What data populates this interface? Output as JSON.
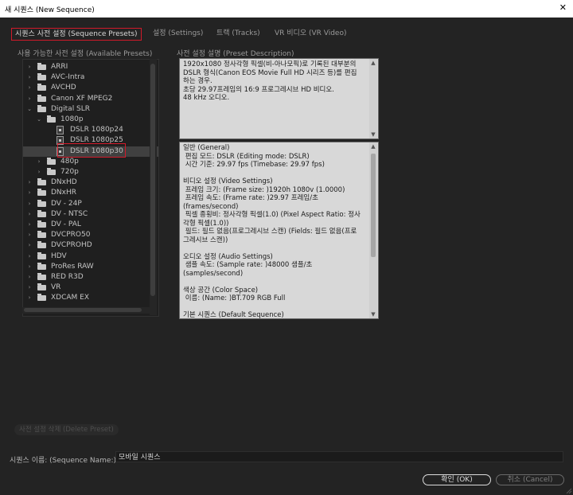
{
  "window": {
    "title": "새 시퀀스 (New Sequence)",
    "close": "✕"
  },
  "tabs": [
    {
      "label": "시퀀스 사전 설정 (Sequence Presets)"
    },
    {
      "label": "설정 (Settings)"
    },
    {
      "label": "트랙 (Tracks)"
    },
    {
      "label": "VR 비디오 (VR Video)"
    }
  ],
  "available_presets": {
    "label": "사용 가능한 사전 설정 (Available Presets)",
    "items": [
      {
        "label": "ARRI",
        "type": "folder",
        "depth": 0,
        "expanded": false
      },
      {
        "label": "AVC-Intra",
        "type": "folder",
        "depth": 0,
        "expanded": false
      },
      {
        "label": "AVCHD",
        "type": "folder",
        "depth": 0,
        "expanded": false
      },
      {
        "label": "Canon XF MPEG2",
        "type": "folder",
        "depth": 0,
        "expanded": false
      },
      {
        "label": "Digital SLR",
        "type": "folder",
        "depth": 0,
        "expanded": true
      },
      {
        "label": "1080p",
        "type": "folder",
        "depth": 1,
        "expanded": true
      },
      {
        "label": "DSLR 1080p24",
        "type": "preset",
        "depth": 2
      },
      {
        "label": "DSLR 1080p25",
        "type": "preset",
        "depth": 2
      },
      {
        "label": "DSLR 1080p30",
        "type": "preset",
        "depth": 2,
        "selected": true
      },
      {
        "label": "480p",
        "type": "folder",
        "depth": 1,
        "expanded": false
      },
      {
        "label": "720p",
        "type": "folder",
        "depth": 1,
        "expanded": false
      },
      {
        "label": "DNxHD",
        "type": "folder",
        "depth": 0,
        "expanded": false
      },
      {
        "label": "DNxHR",
        "type": "folder",
        "depth": 0,
        "expanded": false
      },
      {
        "label": "DV - 24P",
        "type": "folder",
        "depth": 0,
        "expanded": false
      },
      {
        "label": "DV - NTSC",
        "type": "folder",
        "depth": 0,
        "expanded": false
      },
      {
        "label": "DV - PAL",
        "type": "folder",
        "depth": 0,
        "expanded": false
      },
      {
        "label": "DVCPRO50",
        "type": "folder",
        "depth": 0,
        "expanded": false
      },
      {
        "label": "DVCPROHD",
        "type": "folder",
        "depth": 0,
        "expanded": false
      },
      {
        "label": "HDV",
        "type": "folder",
        "depth": 0,
        "expanded": false
      },
      {
        "label": "ProRes RAW",
        "type": "folder",
        "depth": 0,
        "expanded": false
      },
      {
        "label": "RED R3D",
        "type": "folder",
        "depth": 0,
        "expanded": false
      },
      {
        "label": "VR",
        "type": "folder",
        "depth": 0,
        "expanded": false
      },
      {
        "label": "XDCAM EX",
        "type": "folder",
        "depth": 0,
        "expanded": false
      }
    ]
  },
  "preset_description": {
    "label": "사전 설정 설명 (Preset Description)",
    "text": "1920x1080 정사각형 픽셀(비-아나모픽)로 기록된 대부분의 DSLR 형식(Canon EOS Movie Full HD 시리즈 등)를 편집하는 경우.\n초당 29.97프레임의 16:9 프로그레시브 HD 비디오.\n48 kHz 오디오."
  },
  "settings_summary": {
    "text": "일반 (General)\n 편집 모드: DSLR (Editing mode: DSLR)\n 시간 기준: 29.97 fps (Timebase: 29.97 fps)\n\n비디오 설정 (Video Settings)\n 프레임 크기: (Frame size: )1920h 1080v (1.0000)\n 프레임 속도: (Frame rate: )29.97 프레임/초 (frames/second)\n 픽셀 종횡비: 정사각형 픽셀(1.0) (Pixel Aspect Ratio: 정사각형 픽셀(1.0))\n 필드: 필드 없음(프로그레시브 스캔) (Fields: 필드 없음(프로그레시브 스캔))\n\n오디오 설정 (Audio Settings)\n 샘플 속도: (Sample rate: )48000 샘플/초 (samples/second)\n\n색상 공간 (Color Space)\n 이름: (Name: )BT.709 RGB Full\n\n기본 시퀀스 (Default Sequence)"
  },
  "delete_preset": {
    "label": "사전 설정 삭제 (Delete Preset)"
  },
  "sequence_name": {
    "label": "시퀀스 이름: (Sequence Name:)",
    "value": "모바일 시퀀스"
  },
  "buttons": {
    "ok": "확인 (OK)",
    "cancel": "취소 (Cancel)"
  },
  "colors": {
    "background": "#232323",
    "highlight_border": "#d11a2a",
    "text_light": "#c4c4c4"
  }
}
